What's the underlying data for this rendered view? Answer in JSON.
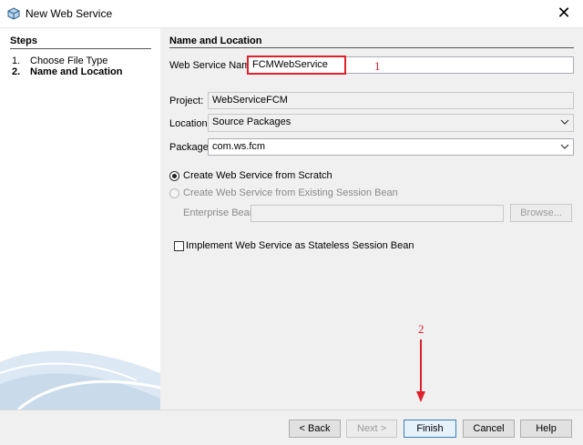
{
  "window": {
    "title": "New Web Service",
    "close_glyph": "✕"
  },
  "steps": {
    "title": "Steps",
    "items": [
      {
        "num": "1.",
        "label": "Choose File Type"
      },
      {
        "num": "2.",
        "label": "Name and Location"
      }
    ]
  },
  "form": {
    "section_title": "Name and Location",
    "service_name": {
      "label": "Web Service Name:",
      "value": "FCMWebService"
    },
    "project": {
      "label": "Project:",
      "value": "WebServiceFCM"
    },
    "location": {
      "label": "Location:",
      "value": "Source Packages"
    },
    "package": {
      "label": "Package:",
      "value": "com.ws.fcm"
    },
    "radio_scratch": {
      "label": "Create Web Service from Scratch"
    },
    "radio_session": {
      "label": "Create Web Service from Existing Session Bean"
    },
    "enterprise_bean": {
      "label": "Enterprise Bean:",
      "value": ""
    },
    "browse": "Browse...",
    "stateless_checkbox": {
      "label": "Implement Web Service as Stateless Session Bean"
    }
  },
  "annotations": {
    "one": "1",
    "two": "2",
    "color": "#e0212b"
  },
  "buttons": {
    "back": "< Back",
    "next": "Next >",
    "finish": "Finish",
    "cancel": "Cancel",
    "help": "Help"
  }
}
